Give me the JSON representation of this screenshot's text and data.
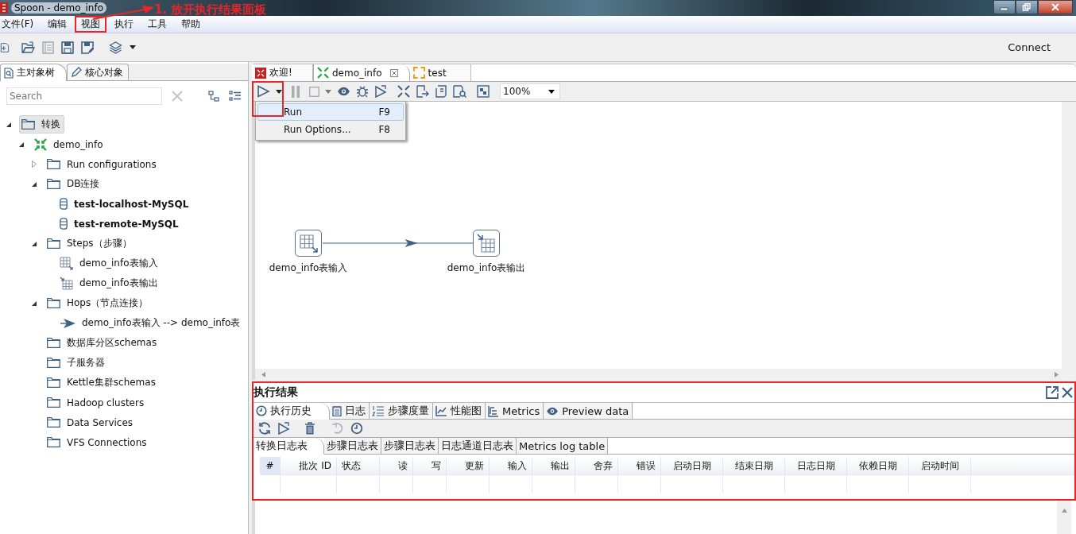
{
  "window": {
    "title": "Spoon - demo_info"
  },
  "annotation": {
    "text": "1. 放开执行结果面板"
  },
  "menu_bar": [
    {
      "label": "文件(F)",
      "marked": false
    },
    {
      "label": "编辑",
      "marked": false
    },
    {
      "label": "视图",
      "marked": true
    },
    {
      "label": "执行",
      "marked": false
    },
    {
      "label": "工具",
      "marked": false
    },
    {
      "label": "帮助",
      "marked": false
    }
  ],
  "main_toolbar": {
    "connect": "Connect"
  },
  "left_panel": {
    "tabs": [
      {
        "label": "主对象树",
        "kind": "tree",
        "selected": true
      },
      {
        "label": "核心对象",
        "kind": "design",
        "selected": false
      }
    ],
    "search": {
      "placeholder": "Search"
    },
    "tree": [
      {
        "label": "转换",
        "kind": "folder",
        "expanded": true,
        "selected": true,
        "children": [
          {
            "label": "demo_info",
            "kind": "transformation",
            "expanded": true,
            "selected": false,
            "children": [
              {
                "label": "Run configurations",
                "kind": "folder",
                "expanded": false,
                "selected": false
              },
              {
                "label": "DB连接",
                "kind": "folder",
                "expanded": true,
                "selected": false,
                "children": [
                  {
                    "label": "test-localhost-MySQL",
                    "kind": "database",
                    "bold": true,
                    "selected": false
                  },
                  {
                    "label": "test-remote-MySQL",
                    "kind": "database",
                    "bold": true,
                    "selected": false
                  }
                ]
              },
              {
                "label": "Steps（步骤）",
                "kind": "folder",
                "expanded": true,
                "selected": false,
                "children": [
                  {
                    "label": "demo_info表输入",
                    "kind": "table_input",
                    "selected": false
                  },
                  {
                    "label": "demo_info表输出",
                    "kind": "table_output",
                    "selected": false
                  }
                ]
              },
              {
                "label": "Hops（节点连接）",
                "kind": "folder",
                "expanded": true,
                "selected": false,
                "children": [
                  {
                    "label": "demo_info表输入 --> demo_info表",
                    "kind": "hop",
                    "selected": false
                  }
                ]
              },
              {
                "label": "数据库分区schemas",
                "kind": "folder",
                "selected": false
              },
              {
                "label": "子服务器",
                "kind": "folder",
                "selected": false
              },
              {
                "label": "Kettle集群schemas",
                "kind": "folder",
                "selected": false
              },
              {
                "label": "Hadoop clusters",
                "kind": "folder",
                "selected": false
              },
              {
                "label": "Data Services",
                "kind": "folder",
                "selected": false
              },
              {
                "label": "VFS Connections",
                "kind": "folder",
                "selected": false
              }
            ]
          }
        ]
      }
    ]
  },
  "editor": {
    "tabs": [
      {
        "label": "欢迎!",
        "kind": "welcome",
        "selected": false,
        "closable": false
      },
      {
        "label": "demo_info",
        "kind": "transformation",
        "selected": true,
        "closable": true
      },
      {
        "label": "test",
        "kind": "job",
        "selected": false,
        "closable": false
      }
    ],
    "toolbar": {
      "run_marked": true,
      "zoom": "100%"
    },
    "run_menu": [
      {
        "label": "Run",
        "shortcut": "F9",
        "selected": true
      },
      {
        "label": "Run Options...",
        "shortcut": "F8",
        "selected": false
      }
    ],
    "canvas": {
      "steps": [
        {
          "label": "demo_info表输入",
          "kind": "table_input"
        },
        {
          "label": "demo_info表输出",
          "kind": "table_output"
        }
      ],
      "hops": [
        {
          "kind": "enabled"
        }
      ]
    }
  },
  "results": {
    "title": "执行结果",
    "marked": true,
    "tabs": [
      {
        "label": "执行历史",
        "kind": "history",
        "selected": true
      },
      {
        "label": "日志",
        "kind": "log",
        "selected": false
      },
      {
        "label": "步骤度量",
        "kind": "metrics_list",
        "selected": false
      },
      {
        "label": "性能图",
        "kind": "chart",
        "selected": false
      },
      {
        "label": "Metrics",
        "kind": "metrics",
        "selected": false
      },
      {
        "label": "Preview data",
        "kind": "preview",
        "selected": false
      }
    ],
    "subtabs": [
      {
        "label": "转换日志表",
        "selected": true
      },
      {
        "label": "步骤日志表",
        "selected": false
      },
      {
        "label": "步骤日志表",
        "selected": false
      },
      {
        "label": "日志通道日志表",
        "selected": false
      },
      {
        "label": "Metrics log table",
        "selected": false
      }
    ],
    "columns": [
      {
        "label": "#",
        "kind": "index"
      },
      {
        "label": "批次 ID",
        "kind": "number"
      },
      {
        "label": "状态",
        "kind": "text"
      },
      {
        "label": "读",
        "kind": "number"
      },
      {
        "label": "写",
        "kind": "number"
      },
      {
        "label": "更新",
        "kind": "number"
      },
      {
        "label": "输入",
        "kind": "number"
      },
      {
        "label": "输出",
        "kind": "number"
      },
      {
        "label": "舍弃",
        "kind": "number"
      },
      {
        "label": "错误",
        "kind": "number"
      },
      {
        "label": "启动日期",
        "kind": "date"
      },
      {
        "label": "结束日期",
        "kind": "date"
      },
      {
        "label": "日志日期",
        "kind": "date"
      },
      {
        "label": "依赖日期",
        "kind": "date"
      },
      {
        "label": "启动时间",
        "kind": "date"
      }
    ]
  }
}
